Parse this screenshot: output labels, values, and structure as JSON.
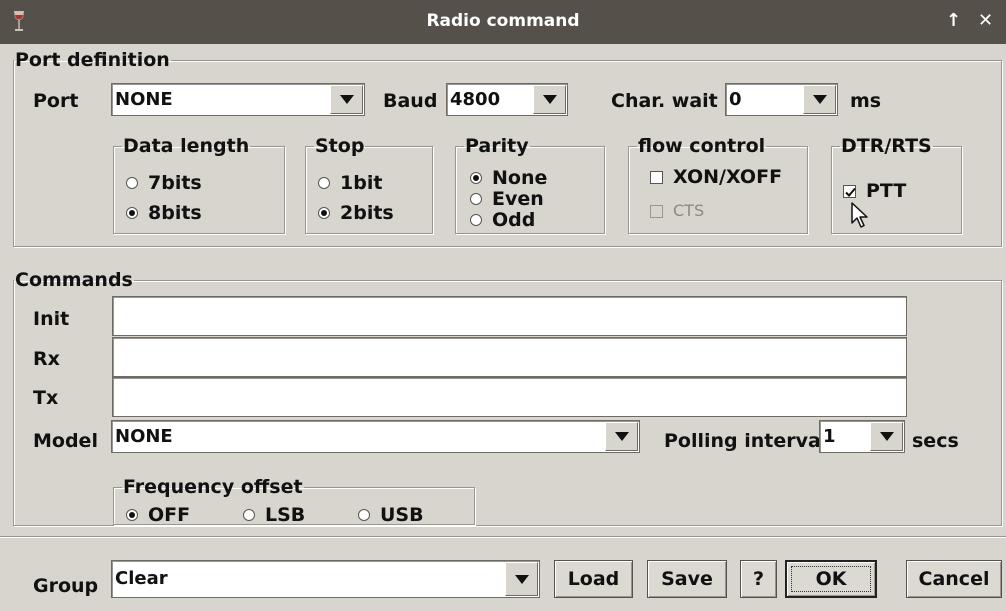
{
  "window": {
    "title": "Radio command",
    "maximize_glyph": "↑",
    "close_glyph": "✕"
  },
  "port_definition": {
    "legend": "Port definition",
    "port": {
      "label": "Port",
      "value": "NONE"
    },
    "baud": {
      "label": "Baud",
      "value": "4800"
    },
    "char_wait": {
      "label": "Char. wait",
      "value": "0",
      "unit": "ms"
    },
    "data_length": {
      "legend": "Data length",
      "options": [
        {
          "label": "7bits",
          "selected": false
        },
        {
          "label": "8bits",
          "selected": true
        }
      ]
    },
    "stop": {
      "legend": "Stop",
      "options": [
        {
          "label": "1bit",
          "selected": false
        },
        {
          "label": "2bits",
          "selected": true
        }
      ]
    },
    "parity": {
      "legend": "Parity",
      "options": [
        {
          "label": "None",
          "selected": true
        },
        {
          "label": "Even",
          "selected": false
        },
        {
          "label": "Odd",
          "selected": false
        }
      ]
    },
    "flow_control": {
      "legend": "flow control",
      "xon_xoff": {
        "label": "XON/XOFF",
        "checked": false
      },
      "cts": {
        "label": "CTS",
        "checked": false,
        "disabled": true
      }
    },
    "dtr_rts": {
      "legend": "DTR/RTS",
      "ptt": {
        "label": "PTT",
        "checked": true
      }
    }
  },
  "commands": {
    "legend": "Commands",
    "init": {
      "label": "Init",
      "value": ""
    },
    "rx": {
      "label": "Rx",
      "value": ""
    },
    "tx": {
      "label": "Tx",
      "value": ""
    },
    "model": {
      "label": "Model",
      "value": "NONE"
    },
    "polling": {
      "label": "Polling interval",
      "value": "1",
      "unit": "secs"
    },
    "frequency_offset": {
      "legend": "Frequency offset",
      "options": [
        {
          "label": "OFF",
          "selected": true
        },
        {
          "label": "LSB",
          "selected": false
        },
        {
          "label": "USB",
          "selected": false
        }
      ]
    }
  },
  "footer": {
    "group": {
      "label": "Group",
      "value": "Clear"
    },
    "buttons": {
      "load": "Load",
      "save": "Save",
      "help": "?",
      "ok": "OK",
      "cancel": "Cancel"
    }
  },
  "colors": {
    "titlebar_bg": "#56504a",
    "window_bg": "#d8d4ce",
    "field_bg": "#ffffff"
  },
  "icons": {
    "app": "wine-glass-icon",
    "dropdown": "triangle-down-icon",
    "cursor": "mouse-pointer-icon"
  }
}
